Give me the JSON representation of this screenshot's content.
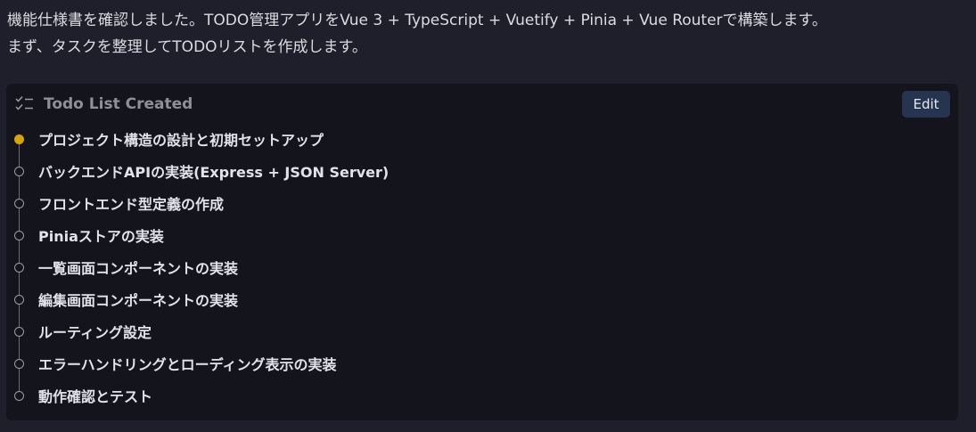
{
  "message": {
    "line1": "機能仕様書を確認しました。TODO管理アプリをVue 3 + TypeScript + Vuetify + Pinia + Vue Routerで構築します。",
    "line2": "まず、タスクを整理してTODOリストを作成します。"
  },
  "todo_card": {
    "title": "Todo List Created",
    "icon": "checklist-icon",
    "edit_label": "Edit",
    "colors": {
      "active_dot": "#d9a406",
      "edit_button_bg": "#263450",
      "card_bg": "#14151c"
    },
    "items": [
      {
        "label": "プロジェクト構造の設計と初期セットアップ",
        "status": "in_progress"
      },
      {
        "label": "バックエンドAPIの実装(Express + JSON Server)",
        "status": "pending"
      },
      {
        "label": "フロントエンド型定義の作成",
        "status": "pending"
      },
      {
        "label": "Piniaストアの実装",
        "status": "pending"
      },
      {
        "label": "一覧画面コンポーネントの実装",
        "status": "pending"
      },
      {
        "label": "編集画面コンポーネントの実装",
        "status": "pending"
      },
      {
        "label": "ルーティング設定",
        "status": "pending"
      },
      {
        "label": "エラーハンドリングとローディング表示の実装",
        "status": "pending"
      },
      {
        "label": "動作確認とテスト",
        "status": "pending"
      }
    ]
  }
}
